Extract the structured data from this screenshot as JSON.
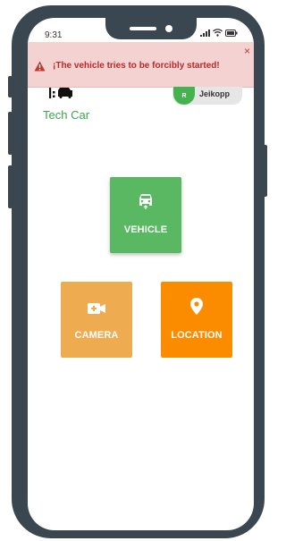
{
  "status_bar": {
    "time": "9:31",
    "icons": [
      "signal-icon",
      "wifi-icon",
      "battery-icon"
    ]
  },
  "alert": {
    "message": "¡The vehicle tries to be forcibly started!",
    "icon": "warning-icon",
    "close_label": "×",
    "color": "#b82a2a",
    "background": "#f5d2d2"
  },
  "brand": {
    "name": "Tech Car",
    "logo_icon": "car-icon",
    "color": "#3aa54a"
  },
  "user": {
    "initial": "R",
    "name": "Jeikopp",
    "avatar_color": "#44b34f"
  },
  "tiles": [
    {
      "label": "VEHICLE",
      "icon": "car-lock-icon",
      "color": "#5bb862"
    },
    {
      "label": "CAMERA",
      "icon": "video-camera-icon",
      "color": "#efab50"
    },
    {
      "label": "LOCATION",
      "icon": "map-pin-icon",
      "color": "#fb8c00"
    }
  ]
}
